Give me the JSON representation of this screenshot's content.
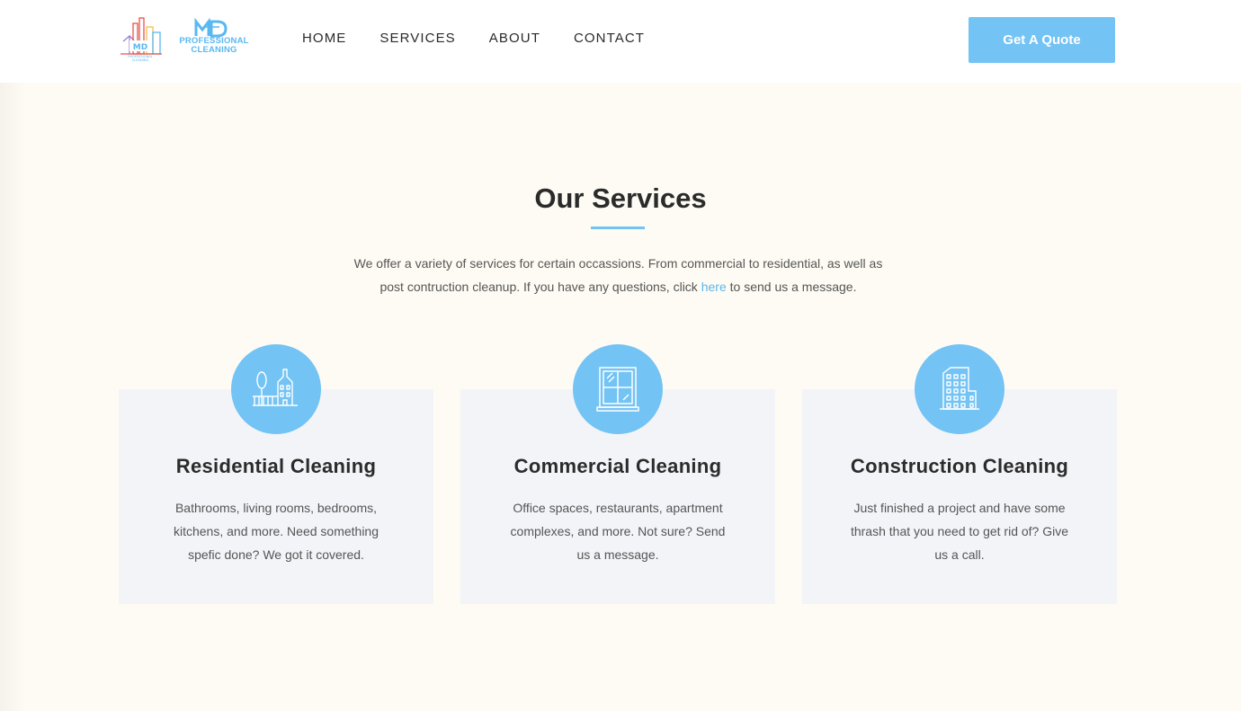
{
  "header": {
    "logo": {
      "mark_text": "MD",
      "sub_line1": "PROFESSIONAL",
      "sub_line2": "CLEANING",
      "colors": {
        "blue": "#5ab8f0",
        "red": "#e8534a",
        "yellow": "#f2c14e",
        "purple": "#9b7fd6"
      }
    },
    "nav": [
      {
        "label": "HOME"
      },
      {
        "label": "SERVICES"
      },
      {
        "label": "ABOUT"
      },
      {
        "label": "CONTACT"
      }
    ],
    "cta_label": "Get A Quote"
  },
  "services": {
    "title": "Our Services",
    "intro_before_link": "We offer a variety of services for certain occassions. From commercial to residential, as well as post contruction cleanup. If you have any questions, click ",
    "intro_link": "here",
    "intro_after_link": " to send us a message.",
    "cards": [
      {
        "icon": "house-icon",
        "title": "Residential Cleaning",
        "description": "Bathrooms, living rooms, bedrooms, kitchens, and more. Need something spefic done? We got it covered."
      },
      {
        "icon": "window-icon",
        "title": "Commercial Cleaning",
        "description": "Office spaces, restaurants, apartment complexes, and more. Not sure? Send us a message."
      },
      {
        "icon": "building-icon",
        "title": "Construction Cleaning",
        "description": "Just finished a project and have some thrash that you need to get rid of? Give us a call."
      }
    ]
  },
  "colors": {
    "accent": "#73c3f5",
    "background": "#fdfbf3",
    "card": "#f3f4f8",
    "text": "#2b2b2b"
  }
}
